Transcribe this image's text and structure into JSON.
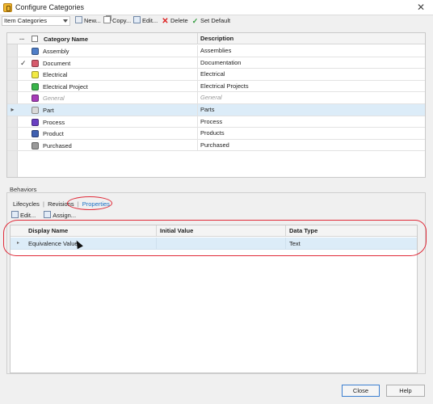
{
  "window": {
    "title": "Configure Categories"
  },
  "toolbar": {
    "category_select": "Item Categories",
    "new_label": "New...",
    "copy_label": "Copy...",
    "edit_label": "Edit...",
    "delete_label": "Delete",
    "set_default_label": "Set Default"
  },
  "categories_grid": {
    "columns": {
      "dots": "...",
      "name": "Category Name",
      "description": "Description"
    },
    "rows": [
      {
        "name": "Assembly",
        "description": "Assemblies",
        "color": "#4f7ec8",
        "check": "",
        "mark": ""
      },
      {
        "name": "Document",
        "description": "Documentation",
        "color": "#d65a6c",
        "check": "✓",
        "mark": ""
      },
      {
        "name": "Electrical",
        "description": "Electrical",
        "color": "#f2ea43",
        "check": "",
        "mark": ""
      },
      {
        "name": "Electrical Project",
        "description": "Electrical Projects",
        "color": "#39b54a",
        "check": "",
        "mark": ""
      },
      {
        "name": "General",
        "description": "General",
        "color": "#a63bb8",
        "check": "",
        "mark": ""
      },
      {
        "name": "Part",
        "description": "Parts",
        "color": "#d9d9d9",
        "check": "",
        "mark": "▸"
      },
      {
        "name": "Process",
        "description": "Process",
        "color": "#6a3fc2",
        "check": "",
        "mark": ""
      },
      {
        "name": "Product",
        "description": "Products",
        "color": "#3f5fb0",
        "check": "",
        "mark": ""
      },
      {
        "name": "Purchased",
        "description": "Purchased",
        "color": "#9a9a9a",
        "check": "",
        "mark": ""
      }
    ]
  },
  "behaviors": {
    "label": "Behaviors",
    "tabs": [
      "Lifecycles",
      "Revisions",
      "Properties"
    ],
    "tab_separator": "|",
    "edit_label": "Edit...",
    "assign_label": "Assign..."
  },
  "properties_grid": {
    "columns": {
      "display_name": "Display Name",
      "initial_value": "Initial Value",
      "data_type": "Data Type"
    },
    "row": {
      "expander": "▸",
      "display_name": "Equivalence Value",
      "initial_value": "",
      "data_type": "Text"
    }
  },
  "footer": {
    "close_label": "Close",
    "help_label": "Help"
  },
  "colors": {
    "annotation_red": "#e02a38",
    "selected_row": "#dcecf8",
    "accent_blue": "#1a6fc4"
  }
}
